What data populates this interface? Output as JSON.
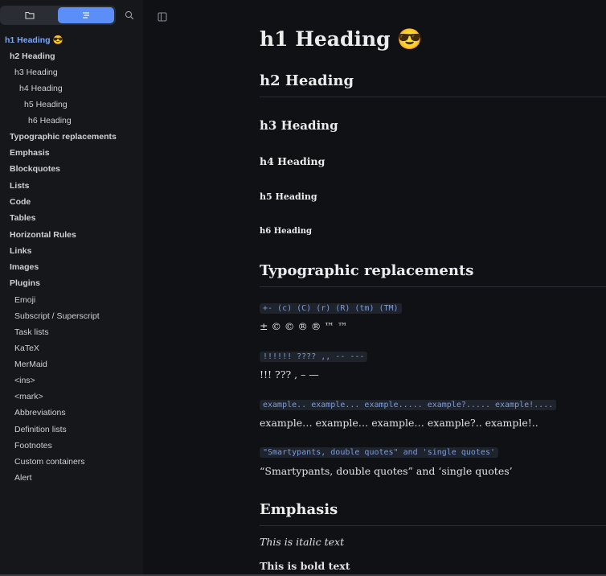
{
  "sidebar": {
    "tabs": [
      {
        "name": "files",
        "icon": "folder-icon"
      },
      {
        "name": "outline",
        "icon": "outline-icon",
        "active": true
      }
    ],
    "search_icon": "search-icon",
    "toc": [
      {
        "label": "h1 Heading 😎",
        "level": 1
      },
      {
        "label": "h2 Heading",
        "level": 2
      },
      {
        "label": "h3 Heading",
        "level": 3
      },
      {
        "label": "h4 Heading",
        "level": 4
      },
      {
        "label": "h5 Heading",
        "level": 5
      },
      {
        "label": "h6 Heading",
        "level": 6
      },
      {
        "label": "Typographic replacements",
        "level": 2
      },
      {
        "label": "Emphasis",
        "level": 2
      },
      {
        "label": "Blockquotes",
        "level": 2
      },
      {
        "label": "Lists",
        "level": 2
      },
      {
        "label": "Code",
        "level": 2
      },
      {
        "label": "Tables",
        "level": 2
      },
      {
        "label": "Horizontal Rules",
        "level": 2
      },
      {
        "label": "Links",
        "level": 2
      },
      {
        "label": "Images",
        "level": 2
      },
      {
        "label": "Plugins",
        "level": 2
      },
      {
        "label": "Emoji",
        "level": 3
      },
      {
        "label": "Subscript / Superscript",
        "level": 3
      },
      {
        "label": "Task lists",
        "level": 3
      },
      {
        "label": "KaTeX",
        "level": 3
      },
      {
        "label": "MerMaid",
        "level": 3
      },
      {
        "label": "<ins>",
        "level": 3
      },
      {
        "label": "<mark>",
        "level": 3
      },
      {
        "label": "Abbreviations",
        "level": 3
      },
      {
        "label": "Definition lists",
        "level": 3
      },
      {
        "label": "Footnotes",
        "level": 3
      },
      {
        "label": "Custom containers",
        "level": 3
      },
      {
        "label": "Alert",
        "level": 3
      }
    ]
  },
  "toolbar": {
    "sidebar_toggle_icon": "sidebar-toggle-icon"
  },
  "document": {
    "h1": "h1 Heading 😎",
    "h2": "h2 Heading",
    "h3": "h3 Heading",
    "h4": "h4 Heading",
    "h5": "h5 Heading",
    "h6": "h6 Heading",
    "typo_heading": "Typographic replacements",
    "code1": "+- (c) (C) (r) (R) (tm) (TM)",
    "text1": "± © © ® ® ™ ™",
    "code2": "!!!!!! ???? ,, -- ---",
    "text2": "!!! ??? , – —",
    "code3": "example.. example... example..... example?..... example!....",
    "text3": "example… example… example… example?.. example!..",
    "code4": "\"Smartypants, double quotes\" and 'single quotes'",
    "text4": "“Smartypants, double quotes” and ‘single quotes’",
    "emphasis_heading": "Emphasis",
    "italic_text": "This is italic text",
    "bold_text": "This is bold text"
  },
  "colors": {
    "accent": "#5b8ef6",
    "active_link": "#7aa7ff",
    "code_text": "#7e9cd8",
    "background": "#0f1115",
    "sidebar_bg": "#15171b"
  }
}
